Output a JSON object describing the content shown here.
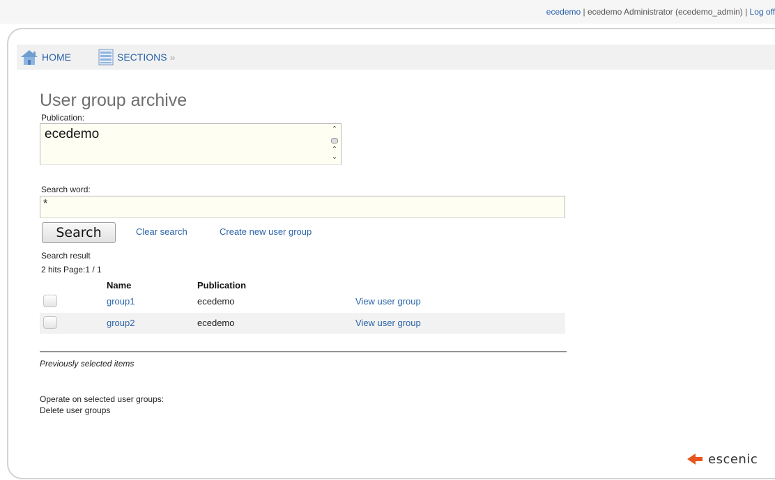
{
  "header": {
    "user_link": "ecedemo",
    "user_info": " | ecedemo Administrator (ecedemo_admin) | ",
    "logoff": "Log off"
  },
  "nav": {
    "home": "HOME",
    "sections": "SECTIONS",
    "sections_arrow": "»"
  },
  "page": {
    "title": "User group archive",
    "publication_label": "Publication:",
    "publication_value": "ecedemo",
    "search_label": "Search word:",
    "search_value": "*"
  },
  "actions": {
    "search_button": "Search",
    "clear_search": "Clear search",
    "create_new": "Create new user group"
  },
  "results": {
    "heading": "Search result",
    "summary": "2 hits Page:1 / 1",
    "columns": {
      "name": "Name",
      "publication": "Publication"
    },
    "rows": [
      {
        "name": "group1",
        "publication": "ecedemo",
        "action": "View user group"
      },
      {
        "name": "group2",
        "publication": "ecedemo",
        "action": "View user group"
      }
    ]
  },
  "footer": {
    "previously_selected": "Previously selected items",
    "operate_label": "Operate on selected user groups:",
    "delete_link": "Delete user groups",
    "logo_text": "escenic"
  },
  "colors": {
    "link": "#2a63a8",
    "input_bg": "#fefef2",
    "logo_accent": "#e8541e"
  },
  "icons": {
    "home": "home-icon",
    "sections": "sections-icon",
    "scroll_up": "chevron-up-icon",
    "scroll_down": "chevron-down-icon",
    "logo": "escenic-arrow-icon"
  }
}
